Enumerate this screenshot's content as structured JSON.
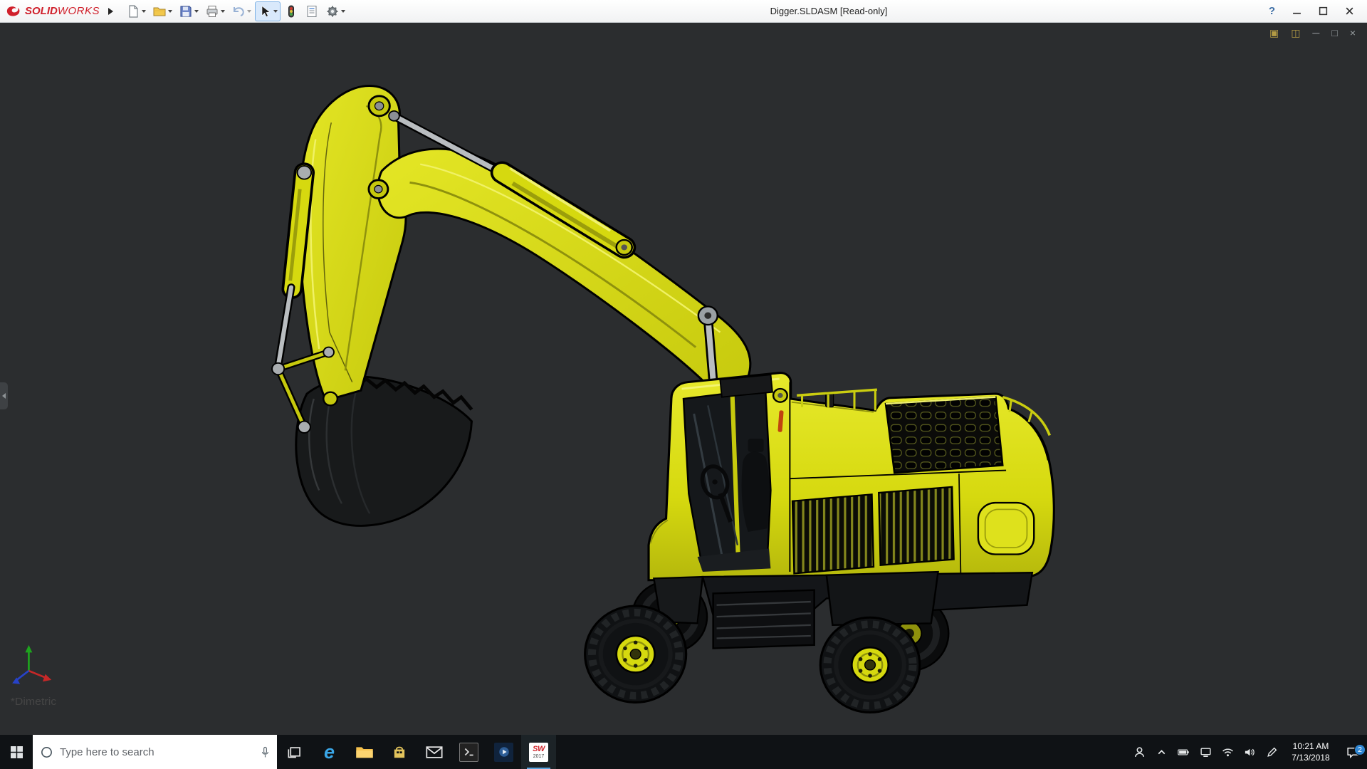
{
  "window": {
    "title": "Digger.SLDASM [Read-only]",
    "help_glyph": "?"
  },
  "brand": {
    "solid": "SOLID",
    "works": "WORKS",
    "accent_color": "#d0202b"
  },
  "toolbar": {
    "tools": [
      "new-document",
      "open",
      "save",
      "print",
      "undo",
      "select",
      "rebuild",
      "file-properties",
      "options"
    ]
  },
  "viewport": {
    "background_color": "#2b2d2f",
    "view_label": "*Dimetric",
    "model_subject": "yellow wheeled excavator assembly",
    "model_color": "#d6d90f",
    "doc_controls": [
      {
        "name": "viewport-gold-icon-1",
        "glyph": "▣"
      },
      {
        "name": "viewport-gold-icon-2",
        "glyph": "◫"
      },
      {
        "name": "doc-minimize",
        "glyph": "─"
      },
      {
        "name": "doc-restore",
        "glyph": "□"
      },
      {
        "name": "doc-close",
        "glyph": "×"
      }
    ]
  },
  "taskbar": {
    "search_placeholder": "Type here to search",
    "edge_glyph": "e",
    "sw_tile": {
      "letters": "SW",
      "year": "2017"
    },
    "pinned_apps": [
      "task-view",
      "edge",
      "file-explorer",
      "store",
      "mail",
      "command-prompt",
      "media-app",
      "solidworks-2017"
    ],
    "tray_icons": [
      "people-icon",
      "chevron-up-icon",
      "battery-icon",
      "ethernet-icon",
      "wifi-icon",
      "volume-icon",
      "pen-icon"
    ],
    "clock": {
      "time": "10:21 AM",
      "date": "7/13/2018"
    },
    "notification_badge": "2"
  }
}
